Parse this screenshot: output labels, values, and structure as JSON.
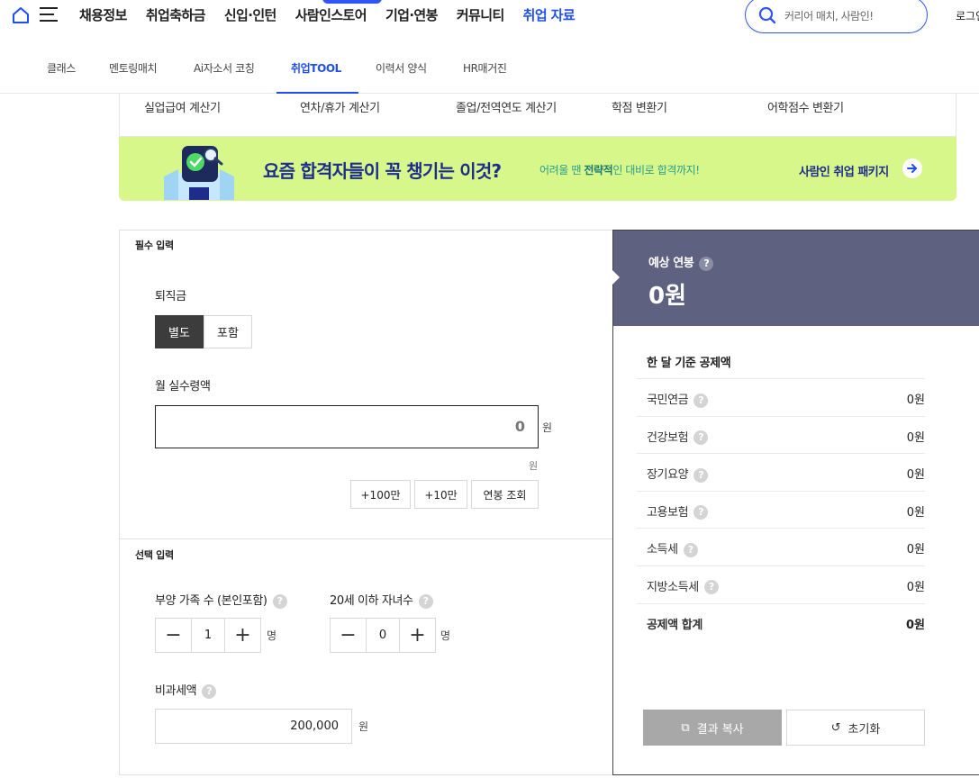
{
  "topnav": {
    "items": [
      "채용정보",
      "취업축하금",
      "신입·인턴",
      "사람인스토어",
      "기업·연봉",
      "커뮤니티",
      "취업 자료"
    ],
    "search_placeholder": "커리어 매치, 사람인!",
    "login_cut": "로그인"
  },
  "subnav": {
    "items": [
      "클래스",
      "멘토링매치",
      "Ai자소서 코칭",
      "취업TOOL",
      "이력서 양식",
      "HR매거진"
    ],
    "active": "취업TOOL"
  },
  "tool_tabs": [
    "실업급여 계산기",
    "연차/휴가 계산기",
    "졸업/전역연도 계산기",
    "학점 변환기",
    "어학점수 변환기"
  ],
  "banner": {
    "title": "요즘 합격자들이 꼭 챙기는 이것?",
    "sub_prefix": "어려울 땐 ",
    "sub_bold": "전략적",
    "sub_suffix": "인 대비로 합격까지!",
    "cta": "사람인 취업 패키지"
  },
  "calculator": {
    "required_label": "필수 입력",
    "severance_label": "퇴직금",
    "severance_options": [
      "별도",
      "포함"
    ],
    "monthly_label": "월 실수령액",
    "monthly_value": "0",
    "unit_won": "원",
    "amount_buttons": [
      "+100만",
      "+10만",
      "연봉 조회"
    ],
    "optional_label": "선택 입력",
    "dependents_label": "부양 가족 수 (본인포함)",
    "dependents_value": "1",
    "children_label": "20세 이하 자녀수",
    "children_value": "0",
    "unit_person": "명",
    "nontax_label": "비과세액",
    "nontax_value": "200,000",
    "help": "?"
  },
  "result": {
    "label": "예상 연봉",
    "value": "0원",
    "deduction_title": "한 달 기준 공제액",
    "rows": [
      {
        "name": "국민연금",
        "value": "0원"
      },
      {
        "name": "건강보험",
        "value": "0원"
      },
      {
        "name": "장기요양",
        "value": "0원"
      },
      {
        "name": "고용보험",
        "value": "0원"
      },
      {
        "name": "소득세",
        "value": "0원"
      },
      {
        "name": "지방소득세",
        "value": "0원"
      }
    ],
    "total_name": "공제액 합계",
    "total_value": "0원",
    "copy_label": "결과 복사",
    "reset_label": "초기화"
  },
  "colors": {
    "accent": "#1f4ef5",
    "banner": "#d7f78a",
    "result_bg": "#5e6280"
  }
}
